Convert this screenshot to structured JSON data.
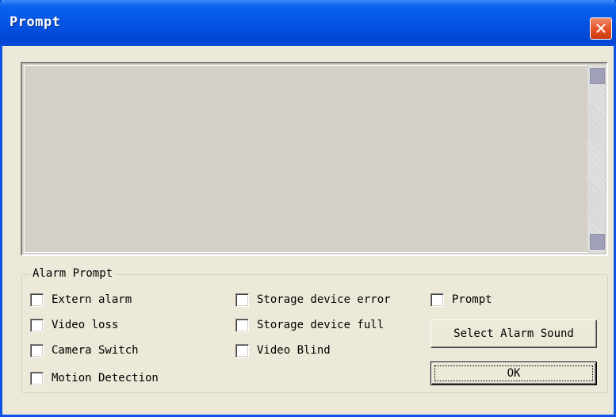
{
  "window": {
    "title": "Prompt"
  },
  "titlebar": {
    "close_symbol": "✕",
    "close_icon": "close-icon"
  },
  "alarm_prompt": {
    "group_label": "Alarm Prompt",
    "checkboxes": [
      {
        "label": "Extern alarm",
        "checked": false
      },
      {
        "label": "Video loss",
        "checked": false
      },
      {
        "label": "Camera Switch",
        "checked": false
      },
      {
        "label": "Motion Detection",
        "checked": false
      },
      {
        "label": "Storage device error",
        "checked": false
      },
      {
        "label": "Storage device full",
        "checked": false
      },
      {
        "label": "Video Blind",
        "checked": false
      },
      {
        "label": "Prompt",
        "checked": false
      }
    ],
    "select_sound_label": "Select Alarm Sound",
    "ok_label": "OK"
  },
  "colors": {
    "titlebar": "#0552e3",
    "dialog_bg": "#ece9d8",
    "close_button": "#e45528"
  }
}
